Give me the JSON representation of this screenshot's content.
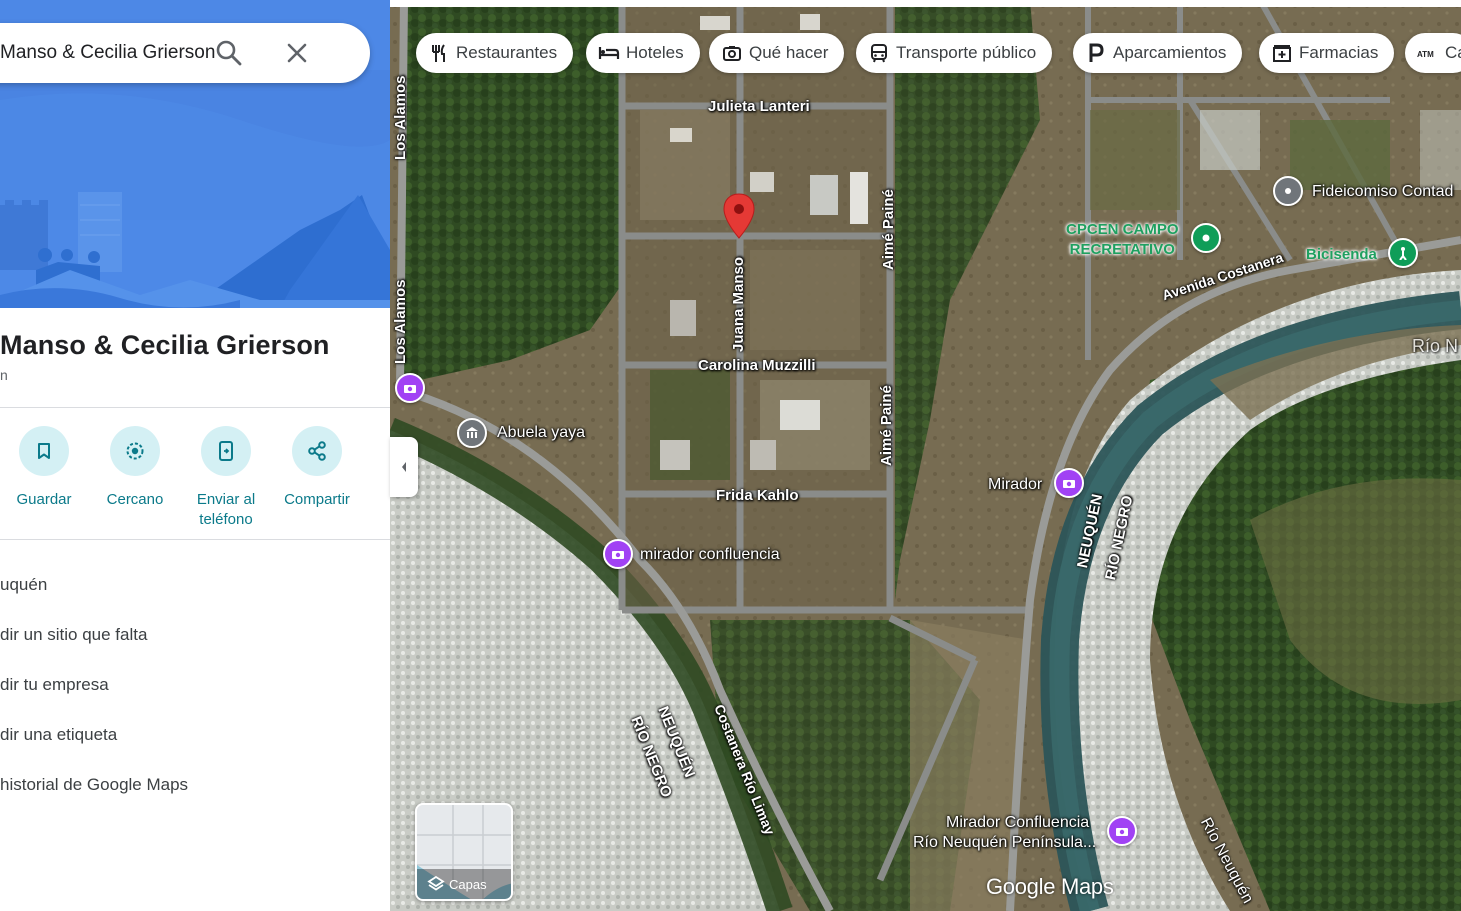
{
  "search": {
    "query": "Manso & Cecilia Grierson"
  },
  "place": {
    "title": "Manso & Cecilia Grierson",
    "subtitle": "n"
  },
  "actions": [
    {
      "label": "Guardar",
      "icon": "bookmark-icon"
    },
    {
      "label": "Cercano",
      "icon": "nearby-icon"
    },
    {
      "label": "Enviar al teléfono",
      "icon": "send-to-phone-icon"
    },
    {
      "label": "Compartir",
      "icon": "share-icon"
    }
  ],
  "menu": [
    "uquén",
    "dir un sitio que falta",
    "dir tu empresa",
    "dir una etiqueta",
    "historial de Google Maps"
  ],
  "chips": [
    {
      "label": "Restaurantes",
      "icon": "restaurant-icon"
    },
    {
      "label": "Hoteles",
      "icon": "hotel-icon"
    },
    {
      "label": "Qué hacer",
      "icon": "camera-icon"
    },
    {
      "label": "Transporte público",
      "icon": "transit-icon"
    },
    {
      "label": "Aparcamientos",
      "icon": "parking-icon"
    },
    {
      "label": "Farmacias",
      "icon": "pharmacy-icon"
    },
    {
      "label": "Ca",
      "icon": "atm-icon"
    }
  ],
  "map": {
    "streets": {
      "julieta": "Julieta Lanteri",
      "carolina": "Carolina Muzzilli",
      "frida": "Frida Kahlo",
      "juana": "Juana Manso",
      "aime1": "Aimé Painé",
      "aime2": "Aimé Painé",
      "alamos1": "Los Alamos",
      "alamos2": "Los Alamos",
      "costanera": "Avenida Costanera",
      "costanera_limay": "Costanera Río Limay"
    },
    "rivers": {
      "neuquen_left": "NEUQUÉN",
      "rionegro_left": "RÍO NEGRO",
      "neuquen_right": "NEUQUÉN",
      "rionegro_right": "RÍO NEGRO",
      "rio_top": "Río N",
      "rio_bottom": "Río Neuquén"
    },
    "pois": {
      "abuela": "Abuela yaya",
      "mirador": "Mirador",
      "mirador_confluencia": "mirador confluencia",
      "mirador_peninsula_1": "Mirador Confluencia",
      "mirador_peninsula_2": "Río Neuquén Península...",
      "cpcen_1": "CPCEN CAMPO",
      "cpcen_2": "RECRETATIVO",
      "bicisenda": "Bicisenda",
      "fideicomiso": "Fideicomiso Contad"
    },
    "layers_label": "Capas",
    "logo": "Google Maps",
    "colors": {
      "pin": "#e53935",
      "poi_purple": "#a142f4",
      "poi_green": "#0f9d58",
      "poi_grey": "#70757a",
      "accent_teal": "#0b7a8a"
    }
  }
}
